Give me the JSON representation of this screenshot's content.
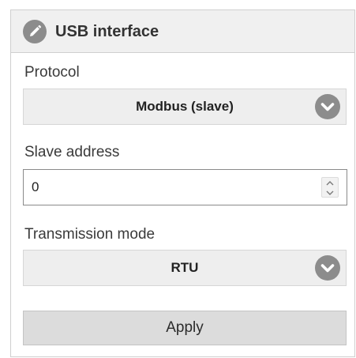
{
  "panel": {
    "title": "USB interface",
    "icon": "pencil-circle-icon"
  },
  "fields": {
    "protocol": {
      "label": "Protocol",
      "value": "Modbus (slave)",
      "icon": "chevron-down-circle-icon"
    },
    "slave_address": {
      "label": "Slave address",
      "value": "0",
      "icon": "spinner-icon"
    },
    "transmission_mode": {
      "label": "Transmission mode",
      "value": "RTU",
      "icon": "chevron-down-circle-icon"
    }
  },
  "actions": {
    "apply_label": "Apply"
  },
  "colors": {
    "header_bg": "#f0f0f0",
    "select_bg": "#eeeeee",
    "button_bg": "#dcdcdc",
    "icon_gray": "#8c8c8c",
    "border": "#cfcfcf"
  }
}
